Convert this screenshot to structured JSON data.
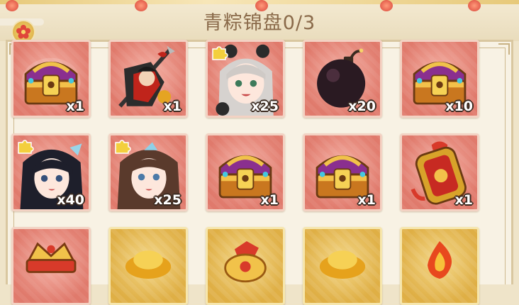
{
  "header": {
    "title": "青粽锦盘0/3"
  },
  "items": [
    {
      "name": "treasure-chest",
      "frame": "red",
      "quantity": "x1",
      "fragment": false
    },
    {
      "name": "hero-portrait-spear",
      "frame": "red",
      "quantity": "x1",
      "fragment": false
    },
    {
      "name": "hero-fragment-silver-hair",
      "frame": "red",
      "quantity": "x25",
      "fragment": true
    },
    {
      "name": "bomb",
      "frame": "red",
      "quantity": "x20",
      "fragment": false
    },
    {
      "name": "treasure-chest",
      "frame": "red",
      "quantity": "x10",
      "fragment": false
    },
    {
      "name": "hero-fragment-dark-hair",
      "frame": "red",
      "quantity": "x40",
      "fragment": true
    },
    {
      "name": "hero-fragment-brown-hair",
      "frame": "red",
      "quantity": "x25",
      "fragment": true
    },
    {
      "name": "treasure-chest",
      "frame": "red",
      "quantity": "x1",
      "fragment": false
    },
    {
      "name": "treasure-chest",
      "frame": "red",
      "quantity": "x1",
      "fragment": false
    },
    {
      "name": "red-gold-token",
      "frame": "red",
      "quantity": "x1",
      "fragment": false
    },
    {
      "name": "gold-crown",
      "frame": "red",
      "quantity": "",
      "fragment": false
    },
    {
      "name": "gold-ingot",
      "frame": "gold",
      "quantity": "",
      "fragment": false
    },
    {
      "name": "gold-coin-bag",
      "frame": "gold",
      "quantity": "",
      "fragment": false
    },
    {
      "name": "gold-ingot",
      "frame": "gold",
      "quantity": "",
      "fragment": false
    },
    {
      "name": "fire-orb",
      "frame": "gold",
      "quantity": "",
      "fragment": false
    }
  ],
  "colors": {
    "title_text": "#8a6a4a",
    "red_frame": "#e07a6c",
    "gold_frame": "#dfaf45",
    "panel_bg": "#f8f2e4"
  }
}
